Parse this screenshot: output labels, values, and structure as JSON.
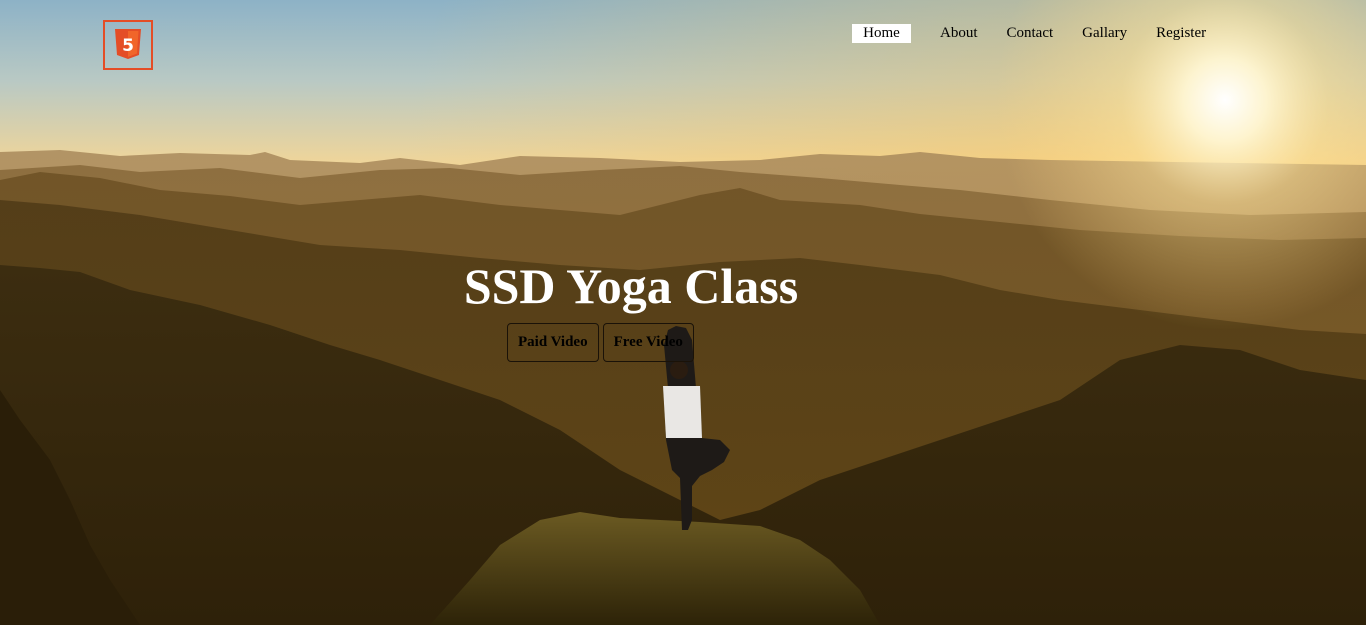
{
  "logo": {
    "icon": "html5-icon",
    "glyph": "5",
    "color": "#e44d26"
  },
  "nav": {
    "items": [
      {
        "label": "Home",
        "active": true
      },
      {
        "label": "About"
      },
      {
        "label": "Contact"
      },
      {
        "label": "Gallary"
      },
      {
        "label": "Register"
      }
    ]
  },
  "hero": {
    "title": "SSD Yoga Class",
    "buttons": {
      "paid": "Paid Video",
      "free": "Free Video"
    }
  },
  "colors": {
    "sky_top": "#8fb3c7",
    "sky_glow": "#f3d28a",
    "sun": "#fffbe8",
    "mountain_dark": "#3b2a0f",
    "title_text": "#ffffff",
    "nav_active_bg": "#ffffff"
  }
}
